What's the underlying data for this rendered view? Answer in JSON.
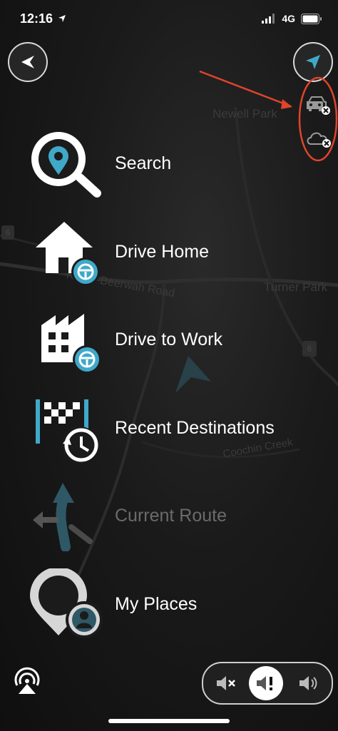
{
  "status": {
    "time": "12:16",
    "network": "4G"
  },
  "map": {
    "labels": [
      "Newell Park",
      "Kilcoy-Beerwah Road",
      "Turner Park",
      "Coochin Creek"
    ],
    "road_signs": [
      "6",
      "6"
    ]
  },
  "menu": {
    "items": [
      {
        "label": "Search",
        "icon": "search-icon"
      },
      {
        "label": "Drive Home",
        "icon": "home-icon"
      },
      {
        "label": "Drive to Work",
        "icon": "work-icon"
      },
      {
        "label": "Recent Destinations",
        "icon": "recent-destinations-icon"
      },
      {
        "label": "Current Route",
        "icon": "current-route-icon",
        "disabled": true
      },
      {
        "label": "My Places",
        "icon": "my-places-icon"
      }
    ]
  },
  "services": {
    "traffic": "traffic-offline-icon",
    "weather": "weather-offline-icon"
  },
  "colors": {
    "accent": "#3fa9c9",
    "annotation": "#e0442b"
  }
}
